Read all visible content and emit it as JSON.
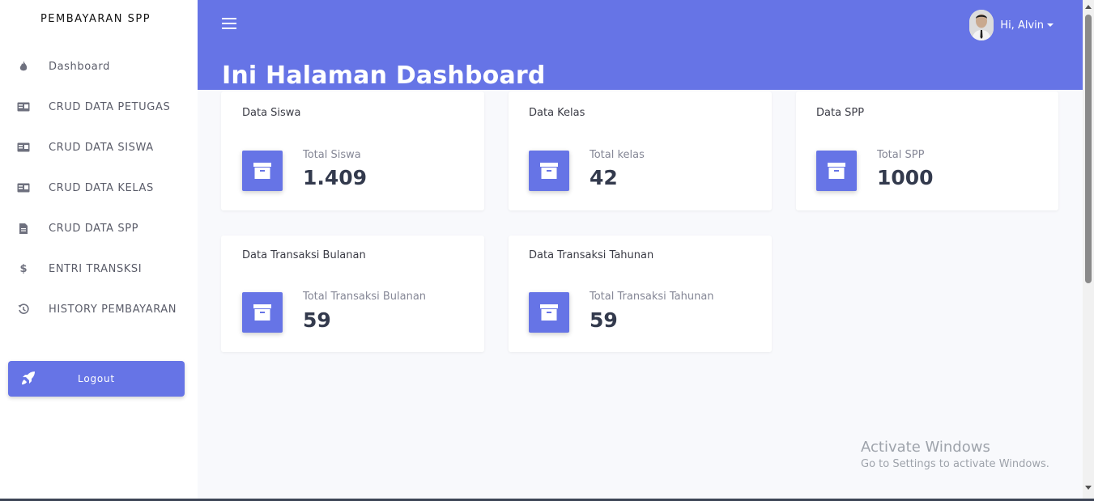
{
  "sidebar": {
    "brand": "PEMBAYARAN SPP",
    "items": [
      {
        "label": "Dashboard",
        "icon": "fire-icon"
      },
      {
        "label": "CRUD DATA PETUGAS",
        "icon": "id-card-icon"
      },
      {
        "label": "CRUD DATA SISWA",
        "icon": "id-card-icon"
      },
      {
        "label": "CRUD DATA KELAS",
        "icon": "id-card-icon"
      },
      {
        "label": "CRUD DATA SPP",
        "icon": "file-icon"
      },
      {
        "label": "ENTRI TRANSKSI",
        "icon": "dollar-icon"
      },
      {
        "label": "HISTORY PEMBAYARAN",
        "icon": "history-icon"
      }
    ],
    "logout_label": "Logout"
  },
  "topbar": {
    "user_greeting": "Hi, Alvin",
    "page_title": "Ini Halaman Dashboard"
  },
  "cards": [
    {
      "title": "Data Siswa",
      "subtitle": "Total Siswa",
      "value": "1.409",
      "icon": "archive-icon"
    },
    {
      "title": "Data Kelas",
      "subtitle": "Total kelas",
      "value": "42",
      "icon": "archive-icon"
    },
    {
      "title": "Data SPP",
      "subtitle": "Total SPP",
      "value": "1000",
      "icon": "archive-icon"
    },
    {
      "title": "Data Transaksi Bulanan",
      "subtitle": "Total Transaksi Bulanan",
      "value": "59",
      "icon": "archive-icon"
    },
    {
      "title": "Data Transaksi Tahunan",
      "subtitle": "Total Transaksi Tahunan",
      "value": "59",
      "icon": "archive-icon"
    }
  ],
  "watermark": {
    "title": "Activate Windows",
    "subtitle": "Go to Settings to activate Windows."
  },
  "colors": {
    "accent": "#6674e6",
    "background": "#f8f9fc",
    "sidebar": "#ffffff"
  }
}
